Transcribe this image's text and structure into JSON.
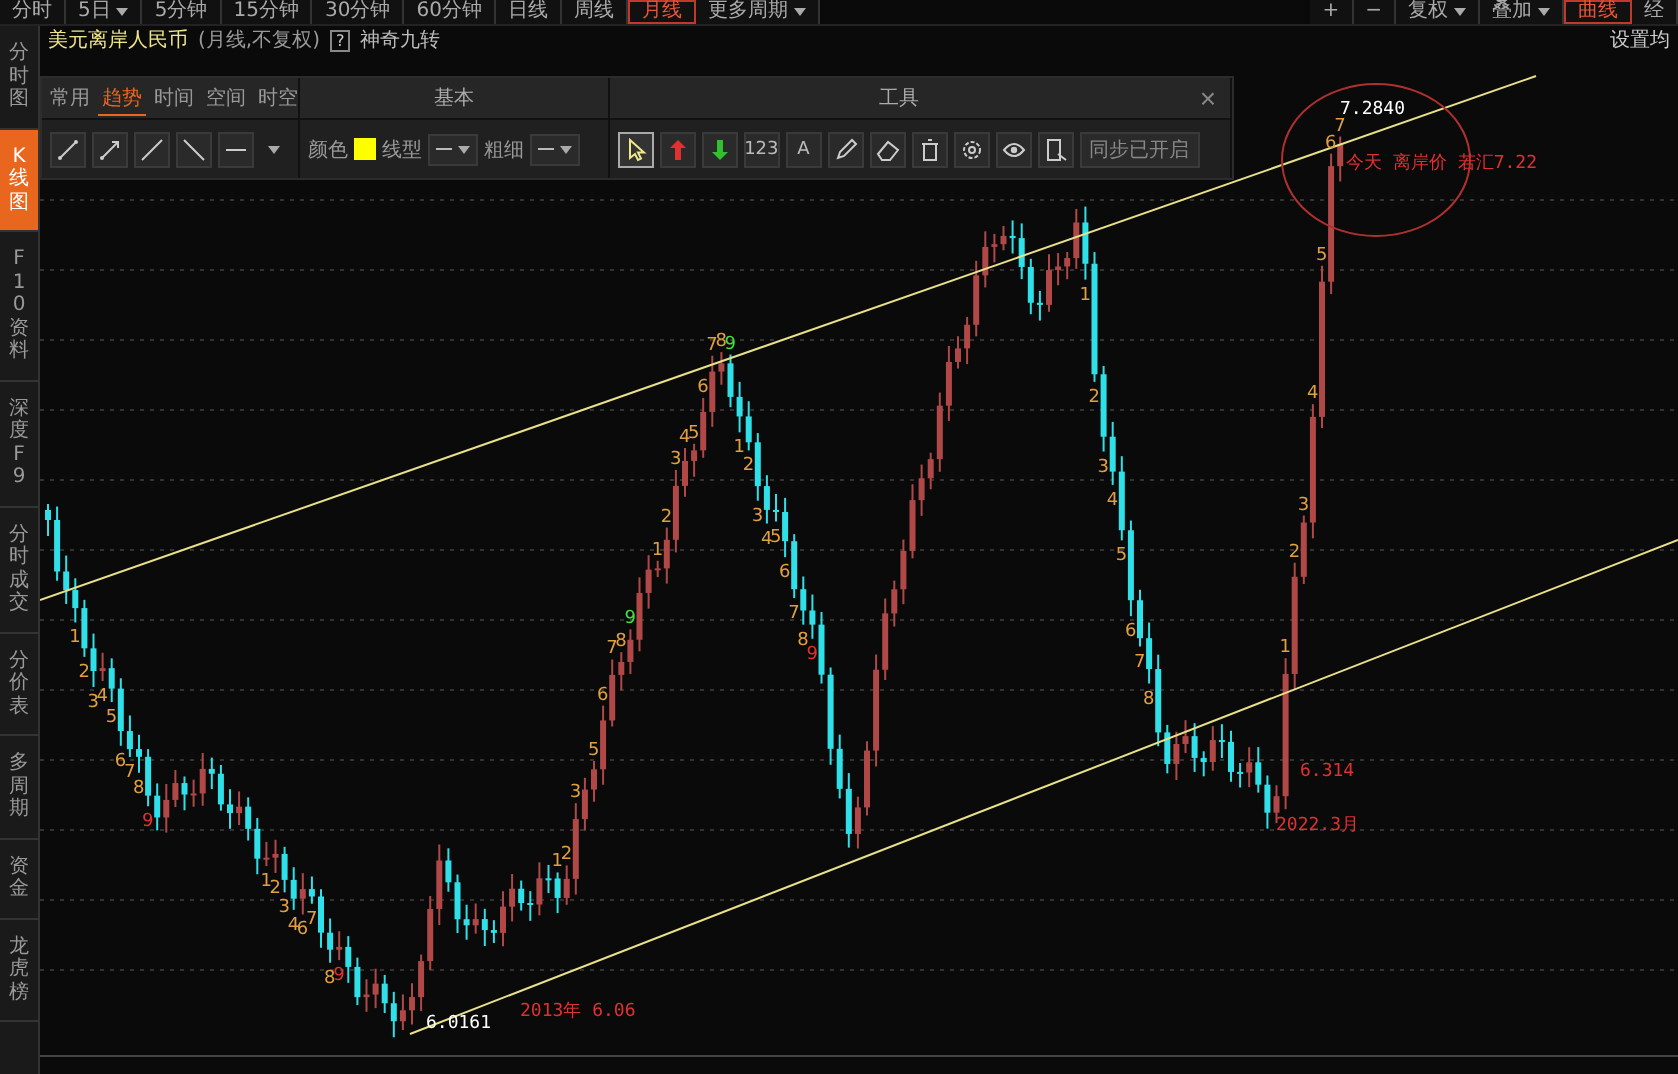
{
  "period_tabs": [
    {
      "label": "分时",
      "selected": false,
      "has_menu": false
    },
    {
      "label": "5日",
      "selected": false,
      "has_menu": true
    },
    {
      "label": "5分钟",
      "selected": false,
      "has_menu": false
    },
    {
      "label": "15分钟",
      "selected": false,
      "has_menu": false
    },
    {
      "label": "30分钟",
      "selected": false,
      "has_menu": false
    },
    {
      "label": "60分钟",
      "selected": false,
      "has_menu": false
    },
    {
      "label": "日线",
      "selected": false,
      "has_menu": false
    },
    {
      "label": "周线",
      "selected": false,
      "has_menu": false
    },
    {
      "label": "月线",
      "selected": true,
      "has_menu": false
    },
    {
      "label": "更多周期",
      "selected": false,
      "has_menu": true
    }
  ],
  "right_controls": [
    {
      "label": "+",
      "selected": false,
      "has_menu": false
    },
    {
      "label": "−",
      "selected": false,
      "has_menu": false
    },
    {
      "label": "复权",
      "selected": false,
      "has_menu": true
    },
    {
      "label": "叠加",
      "selected": false,
      "has_menu": true
    },
    {
      "label": "曲线",
      "selected": true,
      "has_menu": false
    },
    {
      "label": "经",
      "selected": false,
      "has_menu": false
    }
  ],
  "instrument": {
    "name": "美元离岸人民币",
    "mode": "(月线,不复权)",
    "help": "?",
    "indicator": "神奇九转",
    "settings_link": "设置均"
  },
  "sidebar": {
    "items": [
      {
        "label": "分时图",
        "selected": false
      },
      {
        "label": "K线图",
        "selected": true
      },
      {
        "label": "F10资料",
        "selected": false
      },
      {
        "label": "深度F9",
        "selected": false
      },
      {
        "label": "分时成交",
        "selected": false
      },
      {
        "label": "分价表",
        "selected": false
      },
      {
        "label": "多周期",
        "selected": false
      },
      {
        "label": "资金",
        "selected": false
      },
      {
        "label": "龙虎榜",
        "selected": false
      }
    ]
  },
  "draw_panel": {
    "tabs": [
      {
        "label": "常用",
        "selected": false
      },
      {
        "label": "趋势",
        "selected": true
      },
      {
        "label": "时间",
        "selected": false
      },
      {
        "label": "空间",
        "selected": false
      },
      {
        "label": "时空",
        "selected": false
      }
    ],
    "basic_header": "基本",
    "tools_header": "工具",
    "close": "×",
    "line_tools": [
      {
        "kind": "segment"
      },
      {
        "kind": "ray"
      },
      {
        "kind": "line-up"
      },
      {
        "kind": "line-down"
      },
      {
        "kind": "horizontal"
      }
    ],
    "color_label": "颜色",
    "color": "#ffff00",
    "style_label": "线型",
    "width_label": "粗细",
    "tools": [
      {
        "kind": "cursor",
        "selected": true
      },
      {
        "kind": "arrow-up",
        "selected": false
      },
      {
        "kind": "arrow-down",
        "selected": false
      },
      {
        "kind": "counter",
        "label": "123",
        "selected": false
      },
      {
        "kind": "text",
        "label": "A",
        "selected": false
      },
      {
        "kind": "pen",
        "selected": false
      },
      {
        "kind": "eraser",
        "selected": false
      },
      {
        "kind": "trash",
        "selected": false
      },
      {
        "kind": "gear",
        "selected": false
      },
      {
        "kind": "eye",
        "selected": false
      },
      {
        "kind": "frame",
        "selected": false
      }
    ],
    "sync_button": "同步已开启"
  },
  "chart": {
    "marks": [
      {
        "text": "1",
        "color": "#e0a040"
      },
      {
        "text": "2",
        "color": "#e0a040"
      },
      {
        "text": "3",
        "color": "#e0a040"
      },
      {
        "text": "4",
        "color": "#e0a040"
      },
      {
        "text": "5",
        "color": "#e0a040"
      },
      {
        "text": "6",
        "color": "#e0a040"
      },
      {
        "text": "7",
        "color": "#e0a040"
      },
      {
        "text": "8",
        "color": "#e0a040"
      },
      {
        "text": "9",
        "color": "#e03030"
      },
      {
        "text": "1",
        "color": "#e0a040"
      },
      {
        "text": "2",
        "color": "#e0a040"
      },
      {
        "text": "3",
        "color": "#e0a040"
      },
      {
        "text": "4",
        "color": "#e0a040"
      },
      {
        "text": "6",
        "color": "#e0a040"
      },
      {
        "text": "7",
        "color": "#e0a040"
      },
      {
        "text": "8",
        "color": "#e0a040"
      },
      {
        "text": "9",
        "color": "#e03030"
      },
      {
        "text": "1",
        "color": "#e0a040"
      },
      {
        "text": "2",
        "color": "#e0a040"
      },
      {
        "text": "3",
        "color": "#e0a040"
      },
      {
        "text": "5",
        "color": "#e0a040"
      },
      {
        "text": "6",
        "color": "#e0a040"
      },
      {
        "text": "7",
        "color": "#e0a040"
      },
      {
        "text": "8",
        "color": "#e0a040"
      },
      {
        "text": "9",
        "color": "#40e040"
      },
      {
        "text": "1",
        "color": "#e0a040"
      },
      {
        "text": "2",
        "color": "#e0a040"
      },
      {
        "text": "3",
        "color": "#e0a040"
      },
      {
        "text": "4",
        "color": "#e0a040"
      },
      {
        "text": "5",
        "color": "#e0a040"
      },
      {
        "text": "6",
        "color": "#e0a040"
      },
      {
        "text": "7",
        "color": "#e0a040"
      },
      {
        "text": "8",
        "color": "#e0a040"
      },
      {
        "text": "9",
        "color": "#40e040"
      },
      {
        "text": "1",
        "color": "#e0a040"
      },
      {
        "text": "2",
        "color": "#e0a040"
      },
      {
        "text": "3",
        "color": "#e0a040"
      },
      {
        "text": "4",
        "color": "#e0a040"
      },
      {
        "text": "5",
        "color": "#e0a040"
      },
      {
        "text": "6",
        "color": "#e0a040"
      },
      {
        "text": "7",
        "color": "#e0a040"
      },
      {
        "text": "8",
        "color": "#e0a040"
      },
      {
        "text": "9",
        "color": "#e03030"
      },
      {
        "text": "1",
        "color": "#e0a040"
      },
      {
        "text": "2",
        "color": "#e0a040"
      },
      {
        "text": "3",
        "color": "#e0a040"
      },
      {
        "text": "4",
        "color": "#e0a040"
      },
      {
        "text": "5",
        "color": "#e0a040"
      },
      {
        "text": "6",
        "color": "#e0a040"
      },
      {
        "text": "7",
        "color": "#e0a040"
      },
      {
        "text": "8",
        "color": "#e0a040"
      },
      {
        "text": "1",
        "color": "#e0a040"
      },
      {
        "text": "2",
        "color": "#e0a040"
      },
      {
        "text": "3",
        "color": "#e0a040"
      },
      {
        "text": "4",
        "color": "#e0a040"
      },
      {
        "text": "5",
        "color": "#e0a040"
      },
      {
        "text": "6",
        "color": "#e0a040"
      },
      {
        "text": "7",
        "color": "#e0a040"
      }
    ],
    "annotations": [
      {
        "text": "6.0161",
        "color": "#ffffff"
      },
      {
        "text": "2013年 6.06",
        "color": "#e03030"
      },
      {
        "text": "6.314",
        "color": "#e03030"
      },
      {
        "text": "2022.3月",
        "color": "#e03030"
      },
      {
        "text": "7.2840",
        "color": "#ffffff"
      },
      {
        "text": "今天 离岸价 若汇7.22",
        "color": "#e03030"
      }
    ]
  }
}
